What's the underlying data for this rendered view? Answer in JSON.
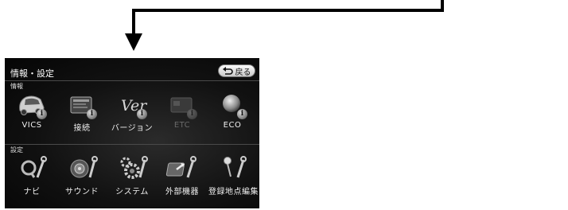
{
  "screen": {
    "title": "情報・設定",
    "back_label": "戻る",
    "sections": [
      {
        "label": "情報",
        "items": [
          {
            "label": "VICS",
            "icon": "car-info-icon",
            "enabled": true
          },
          {
            "label": "接続",
            "icon": "connection-info-icon",
            "enabled": true
          },
          {
            "label": "バージョン",
            "icon": "version-info-icon",
            "enabled": true
          },
          {
            "label": "ETC",
            "icon": "etc-card-icon",
            "enabled": false
          },
          {
            "label": "ECO",
            "icon": "eco-globe-icon",
            "enabled": true
          }
        ]
      },
      {
        "label": "設定",
        "items": [
          {
            "label": "ナビ",
            "icon": "navi-wrench-icon",
            "enabled": true
          },
          {
            "label": "サウンド",
            "icon": "sound-wrench-icon",
            "enabled": true
          },
          {
            "label": "システム",
            "icon": "system-gears-icon",
            "enabled": true
          },
          {
            "label": "外部機器",
            "icon": "external-device-icon",
            "enabled": true
          },
          {
            "label": "登録地点編集",
            "icon": "registered-point-icon",
            "enabled": true
          }
        ]
      }
    ]
  },
  "colors": {
    "screen_background": "#111111",
    "text": "#f2f2f2",
    "disabled_text": "#6a6a6a",
    "back_button": "#e6e6e6"
  }
}
